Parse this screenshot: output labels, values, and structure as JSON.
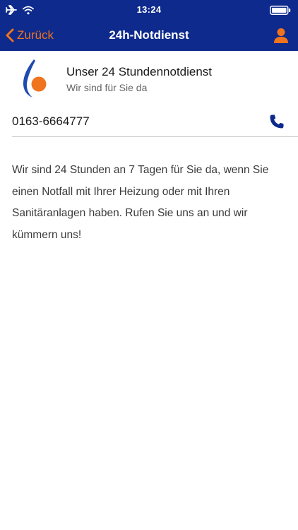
{
  "status_bar": {
    "time": "13:24",
    "icons": [
      "airplane-icon",
      "wifi-icon",
      "battery-icon"
    ]
  },
  "navbar": {
    "back_label": "Zurück",
    "title": "24h-Notdienst",
    "user_icon": "user-icon"
  },
  "header": {
    "title": "Unser 24 Stundennotdienst",
    "subtitle": "Wir sind für Sie da"
  },
  "contact": {
    "phone": "0163-6664777",
    "phone_icon": "phone-icon"
  },
  "description": "Wir sind 24 Stunden an 7 Tagen für Sie da, wenn Sie einen Notfall mit Ihrer Heizung oder mit Ihren Sanitäranlagen haben. Rufen Sie uns an und wir kümmern uns!",
  "colors": {
    "navbar": "#0d2a8c",
    "accent": "#f0731e",
    "logo_blue": "#1f4bb0",
    "phone_icon": "#0d2a8c"
  }
}
